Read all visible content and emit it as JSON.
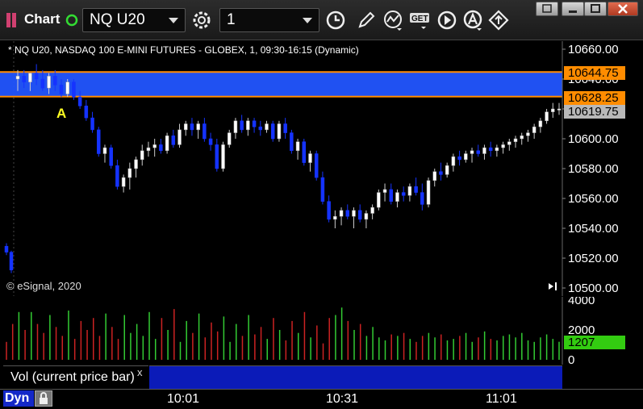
{
  "toolbar": {
    "app_label": "Chart",
    "symbol": "NQ U20",
    "interval": "1",
    "icons": [
      "chart-app-icon",
      "link-status-icon",
      "settings-icon",
      "clock-icon",
      "pencil-icon",
      "study-icon",
      "get-icon",
      "play-icon",
      "alert-icon",
      "sync-icon",
      "restore-window-icon",
      "minimize-icon",
      "maximize-icon",
      "close-icon"
    ]
  },
  "chart": {
    "title": "* NQ U20, NASDAQ 100 E-MINI FUTURES - GLOBEX, 1, 09:30-16:15 (Dynamic)",
    "copyright": "© eSignal, 2020",
    "marker_label": "A",
    "price_axis": [
      "10660.00",
      "10640.00",
      "10620.00",
      "10600.00",
      "10580.00",
      "10560.00",
      "10540.00",
      "10520.00",
      "10500.00"
    ],
    "price_tags": {
      "upper": "10644.75",
      "lower": "10628.25",
      "last": "10619.75"
    },
    "zone_color": "#2255ff",
    "zone_border": "#ff8c00",
    "up_color": "#ffffff",
    "down_color": "#1533ff"
  },
  "volume": {
    "axis": [
      "4000",
      "2000",
      "0"
    ],
    "last": "1207",
    "label": "Vol (current price bar)",
    "close_symbol": "x",
    "up_color": "#33cc33",
    "down_color": "#cc2222",
    "last_color": "#33cc11"
  },
  "time_axis": [
    "10:01",
    "10:31",
    "11:01"
  ],
  "bottom": {
    "mode": "Dyn"
  },
  "chart_data": {
    "type": "candlestick",
    "symbol": "NQ U20",
    "ylim": [
      10500,
      10665
    ],
    "y_ticks": [
      10660,
      10640,
      10620,
      10600,
      10580,
      10560,
      10540,
      10520,
      10500
    ],
    "x_ticks": [
      "10:01",
      "10:31",
      "11:01"
    ],
    "zone": {
      "top": 10644.75,
      "bottom": 10628.25
    },
    "last_price": 10619.75,
    "candles": [
      [
        10528,
        10530,
        10522,
        10524
      ],
      [
        10524,
        10525,
        10510,
        10512
      ],
      [
        10640,
        10646,
        10632,
        10642
      ],
      [
        10642,
        10646,
        10634,
        10638
      ],
      [
        10638,
        10644,
        10632,
        10644
      ],
      [
        10644,
        10650,
        10636,
        10640
      ],
      [
        10640,
        10646,
        10632,
        10634
      ],
      [
        10634,
        10644,
        10630,
        10642
      ],
      [
        10642,
        10646,
        10632,
        10636
      ],
      [
        10636,
        10640,
        10628,
        10630
      ],
      [
        10630,
        10640,
        10628,
        10638
      ],
      [
        10638,
        10640,
        10626,
        10628
      ],
      [
        10628,
        10632,
        10620,
        10622
      ],
      [
        10622,
        10626,
        10612,
        10614
      ],
      [
        10614,
        10618,
        10604,
        10606
      ],
      [
        10606,
        10608,
        10588,
        10590
      ],
      [
        10590,
        10596,
        10584,
        10594
      ],
      [
        10594,
        10596,
        10580,
        10582
      ],
      [
        10582,
        10586,
        10566,
        10568
      ],
      [
        10568,
        10576,
        10564,
        10574
      ],
      [
        10574,
        10584,
        10566,
        10580
      ],
      [
        10580,
        10588,
        10574,
        10586
      ],
      [
        10586,
        10596,
        10582,
        10592
      ],
      [
        10592,
        10598,
        10588,
        10594
      ],
      [
        10594,
        10600,
        10588,
        10596
      ],
      [
        10596,
        10600,
        10590,
        10592
      ],
      [
        10592,
        10604,
        10590,
        10602
      ],
      [
        10602,
        10606,
        10594,
        10596
      ],
      [
        10596,
        10610,
        10594,
        10606
      ],
      [
        10606,
        10612,
        10602,
        10610
      ],
      [
        10610,
        10614,
        10602,
        10606
      ],
      [
        10606,
        10612,
        10600,
        10610
      ],
      [
        10610,
        10614,
        10598,
        10600
      ],
      [
        10600,
        10604,
        10592,
        10596
      ],
      [
        10596,
        10600,
        10578,
        10580
      ],
      [
        10580,
        10598,
        10578,
        10596
      ],
      [
        10596,
        10606,
        10594,
        10604
      ],
      [
        10604,
        10614,
        10600,
        10612
      ],
      [
        10612,
        10616,
        10604,
        10606
      ],
      [
        10606,
        10614,
        10602,
        10612
      ],
      [
        10612,
        10614,
        10604,
        10608
      ],
      [
        10608,
        10612,
        10602,
        10606
      ],
      [
        10606,
        10612,
        10604,
        10610
      ],
      [
        10610,
        10612,
        10598,
        10600
      ],
      [
        10600,
        10612,
        10598,
        10610
      ],
      [
        10610,
        10614,
        10600,
        10604
      ],
      [
        10604,
        10606,
        10590,
        10592
      ],
      [
        10592,
        10600,
        10586,
        10598
      ],
      [
        10598,
        10600,
        10582,
        10584
      ],
      [
        10584,
        10592,
        10578,
        10590
      ],
      [
        10590,
        10592,
        10572,
        10574
      ],
      [
        10574,
        10578,
        10556,
        10558
      ],
      [
        10558,
        10562,
        10544,
        10546
      ],
      [
        10546,
        10552,
        10540,
        10548
      ],
      [
        10548,
        10554,
        10542,
        10552
      ],
      [
        10552,
        10556,
        10546,
        10548
      ],
      [
        10548,
        10554,
        10540,
        10552
      ],
      [
        10552,
        10556,
        10544,
        10546
      ],
      [
        10546,
        10552,
        10540,
        10550
      ],
      [
        10550,
        10556,
        10546,
        10554
      ],
      [
        10554,
        10566,
        10552,
        10564
      ],
      [
        10564,
        10570,
        10558,
        10566
      ],
      [
        10566,
        10570,
        10556,
        10558
      ],
      [
        10558,
        10566,
        10554,
        10564
      ],
      [
        10564,
        10568,
        10558,
        10562
      ],
      [
        10562,
        10570,
        10558,
        10568
      ],
      [
        10568,
        10574,
        10562,
        10564
      ],
      [
        10564,
        10570,
        10552,
        10556
      ],
      [
        10556,
        10574,
        10554,
        10572
      ],
      [
        10572,
        10580,
        10568,
        10578
      ],
      [
        10578,
        10584,
        10572,
        10576
      ],
      [
        10576,
        10584,
        10574,
        10582
      ],
      [
        10582,
        10590,
        10578,
        10588
      ],
      [
        10588,
        10592,
        10582,
        10586
      ],
      [
        10586,
        10592,
        10584,
        10590
      ],
      [
        10590,
        10594,
        10584,
        10592
      ],
      [
        10592,
        10596,
        10588,
        10590
      ],
      [
        10590,
        10596,
        10586,
        10594
      ],
      [
        10594,
        10598,
        10588,
        10592
      ],
      [
        10592,
        10596,
        10588,
        10594
      ],
      [
        10594,
        10598,
        10590,
        10596
      ],
      [
        10596,
        10600,
        10592,
        10598
      ],
      [
        10598,
        10602,
        10594,
        10600
      ],
      [
        10600,
        10604,
        10596,
        10602
      ],
      [
        10602,
        10606,
        10598,
        10604
      ],
      [
        10604,
        10610,
        10600,
        10608
      ],
      [
        10608,
        10614,
        10604,
        10612
      ],
      [
        10612,
        10620,
        10610,
        10618
      ],
      [
        10618,
        10624,
        10614,
        10620
      ],
      [
        10620,
        10624,
        10616,
        10620
      ]
    ],
    "volume": [
      1200,
      2400,
      3200,
      2000,
      3200,
      2400,
      1800,
      3000,
      2200,
      1600,
      3300,
      1400,
      2600,
      2000,
      2800,
      1600,
      3100,
      2200,
      1400,
      3000,
      1800,
      2400,
      1600,
      3200,
      1400,
      2800,
      2000,
      3400,
      1200,
      2600,
      1800,
      3100,
      1500,
      2500,
      1900,
      2900,
      1200,
      2400,
      1600,
      3000,
      1700,
      2200,
      1400,
      2800,
      2000,
      1300,
      2600,
      1800,
      3200,
      1500,
      2300,
      1100,
      2800,
      3000,
      3500,
      2600,
      2000,
      2400,
      1600,
      2200,
      1500,
      1300,
      1700,
      1600,
      1800,
      1400,
      1200,
      1600,
      1800,
      1500,
      1700,
      1300,
      1400,
      1600,
      1800,
      1200,
      1500,
      1900,
      1400,
      1300,
      1600,
      1700,
      1500,
      1800,
      1300,
      1200,
      1500,
      1700,
      1400,
      1207
    ]
  }
}
